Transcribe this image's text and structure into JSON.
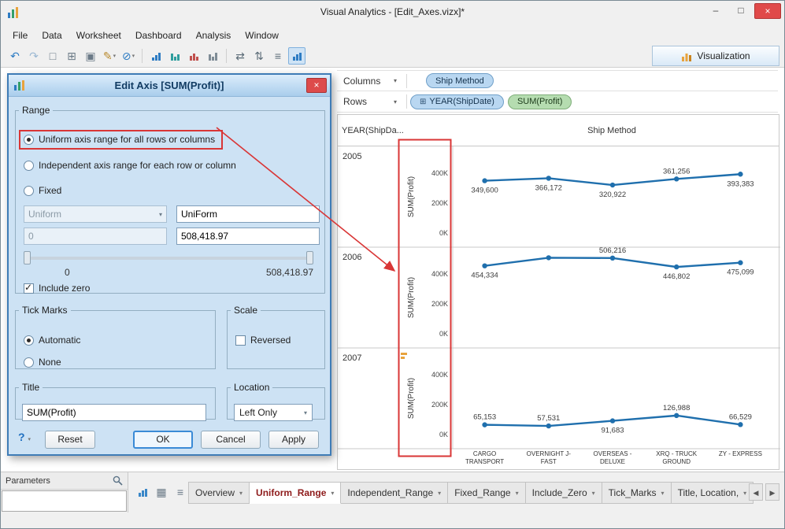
{
  "window": {
    "title": "Visual Analytics - [Edit_Axes.vizx]*",
    "controls": {
      "minimize": "–",
      "maximize": "□",
      "close": "×"
    }
  },
  "menu": {
    "items": [
      "File",
      "Data",
      "Worksheet",
      "Dashboard",
      "Analysis",
      "Window"
    ]
  },
  "toolbar": {
    "visualization_label": "Visualization",
    "items": [
      {
        "name": "undo",
        "glyph": "↶",
        "color": "#2e7cc3"
      },
      {
        "name": "redo",
        "glyph": "↷",
        "color": "#9bb8d3"
      },
      {
        "name": "new-file",
        "glyph": "□",
        "color": "#6b7a87"
      },
      {
        "name": "add-data",
        "glyph": "⊞",
        "color": "#6b7a87"
      },
      {
        "name": "save",
        "glyph": "▣",
        "color": "#6b7a87"
      },
      {
        "name": "format",
        "glyph": "✎",
        "color": "#b98a2e",
        "dropdown": true
      },
      {
        "name": "pause-updates",
        "glyph": "⊘",
        "color": "#2e7cc3",
        "dropdown": true
      },
      {
        "sep": true
      },
      {
        "name": "bar-chart-blue",
        "bars": [
          4,
          7,
          10
        ],
        "color": "#2e7cc3"
      },
      {
        "name": "bar-chart-teal",
        "bars": [
          9,
          5,
          8
        ],
        "color": "#2f9e9e"
      },
      {
        "name": "bar-chart-red",
        "bars": [
          6,
          9,
          5
        ],
        "color": "#c0504d"
      },
      {
        "name": "bar-chart-gray",
        "bars": [
          8,
          5,
          10
        ],
        "color": "#7f8c96"
      },
      {
        "sep": true
      },
      {
        "name": "swap-axes",
        "glyph": "⇄",
        "color": "#5b6b77"
      },
      {
        "name": "sort-values",
        "glyph": "⇅",
        "color": "#5b6b77"
      },
      {
        "name": "grid-lines",
        "glyph": "≡",
        "color": "#5b6b77"
      },
      {
        "name": "show-axes",
        "bars": [
          5,
          8,
          10
        ],
        "color": "#2e7cc3",
        "active": true
      }
    ]
  },
  "shelves": {
    "columns": {
      "label": "Columns",
      "pills": [
        {
          "label": "Ship Method",
          "kind": "dimension"
        }
      ]
    },
    "rows": {
      "label": "Rows",
      "pills": [
        {
          "label": "YEAR(ShipDate)",
          "kind": "dimension",
          "expander": "⊞"
        },
        {
          "label": "SUM(Profit)",
          "kind": "measure"
        }
      ]
    }
  },
  "chart_data": {
    "type": "line",
    "row_header": "YEAR(ShipDa...",
    "col_header": "Ship Method",
    "ylabel": "SUM(Profit)",
    "ylim": [
      0,
      508419
    ],
    "yticks": [
      {
        "label": "400K",
        "value": 400000
      },
      {
        "label": "200K",
        "value": 200000
      },
      {
        "label": "0K",
        "value": 0
      }
    ],
    "categories": [
      "CARGO TRANSPORT",
      "OVERNIGHT J-FAST",
      "OVERSEAS - DELUXE",
      "XRQ - TRUCK GROUND",
      "ZY - EXPRESS"
    ],
    "line_color": "#1f6fad",
    "series": [
      {
        "name": "2005",
        "values": [
          349600,
          366172,
          320922,
          361256,
          393383
        ],
        "labels": [
          "349,600",
          "366,172",
          "320,922",
          "361,256",
          "393,383"
        ],
        "label_side": [
          "below",
          "below",
          "below",
          "above",
          "below"
        ]
      },
      {
        "name": "2006",
        "values": [
          454334,
          508419,
          506216,
          446802,
          475099
        ],
        "labels": [
          "454,334",
          "",
          "506,216",
          "446,802",
          "475,099"
        ],
        "label_side": [
          "below",
          "above",
          "above",
          "below",
          "below"
        ]
      },
      {
        "name": "2007",
        "values": [
          65153,
          57531,
          91683,
          126988,
          66529
        ],
        "labels": [
          "65,153",
          "57,531",
          "91,683",
          "126,988",
          "66,529"
        ],
        "label_side": [
          "above",
          "above",
          "below",
          "above",
          "above"
        ]
      }
    ]
  },
  "dialog": {
    "title": "Edit Axis [SUM(Profit)]",
    "close": "×",
    "range": {
      "legend": "Range",
      "options": [
        {
          "label": "Uniform axis range for all rows or columns",
          "selected": true
        },
        {
          "label": "Independent axis range for each row or column",
          "selected": false
        },
        {
          "label": "Fixed",
          "selected": false
        }
      ],
      "combo_value": "Uniform",
      "name_value": "UniForm",
      "min_value": "0",
      "max_value": "508,418.97",
      "slider_min_label": "0",
      "slider_max_label": "508,418.97",
      "include_zero": {
        "label": "Include zero",
        "checked": true
      }
    },
    "tick_marks": {
      "legend": "Tick Marks",
      "options": [
        {
          "label": "Automatic",
          "selected": true
        },
        {
          "label": "None",
          "selected": false
        }
      ]
    },
    "scale": {
      "legend": "Scale",
      "reversed": {
        "label": "Reversed",
        "checked": false
      }
    },
    "title_group": {
      "legend": "Title",
      "value": "SUM(Profit)"
    },
    "location_group": {
      "legend": "Location",
      "value": "Left Only"
    },
    "buttons": {
      "help": "?",
      "reset": "Reset",
      "ok": "OK",
      "cancel": "Cancel",
      "apply": "Apply"
    }
  },
  "parameters": {
    "label": "Parameters"
  },
  "bottom_icons": [
    {
      "name": "new-sheet",
      "bars": [
        5,
        8,
        10
      ],
      "color": "#3a87c8"
    },
    {
      "name": "grid-view",
      "glyph": "▦",
      "color": "#6b7a87"
    },
    {
      "name": "list-view",
      "glyph": "≡",
      "color": "#6b7a87"
    }
  ],
  "tabs": {
    "items": [
      {
        "label": "Overview"
      },
      {
        "label": "Uniform_Range",
        "active": true
      },
      {
        "label": "Independent_Range"
      },
      {
        "label": "Fixed_Range"
      },
      {
        "label": "Include_Zero"
      },
      {
        "label": "Tick_Marks"
      },
      {
        "label": "Title, Location,"
      }
    ],
    "nav": {
      "prev": "◀",
      "next": "▶"
    }
  },
  "colors": {
    "annotation": "#d93636",
    "accent": "#2e7cc3",
    "pill_dimension": "#b9d7f1",
    "pill_measure": "#b5dcb0",
    "line": "#1f6fad"
  }
}
